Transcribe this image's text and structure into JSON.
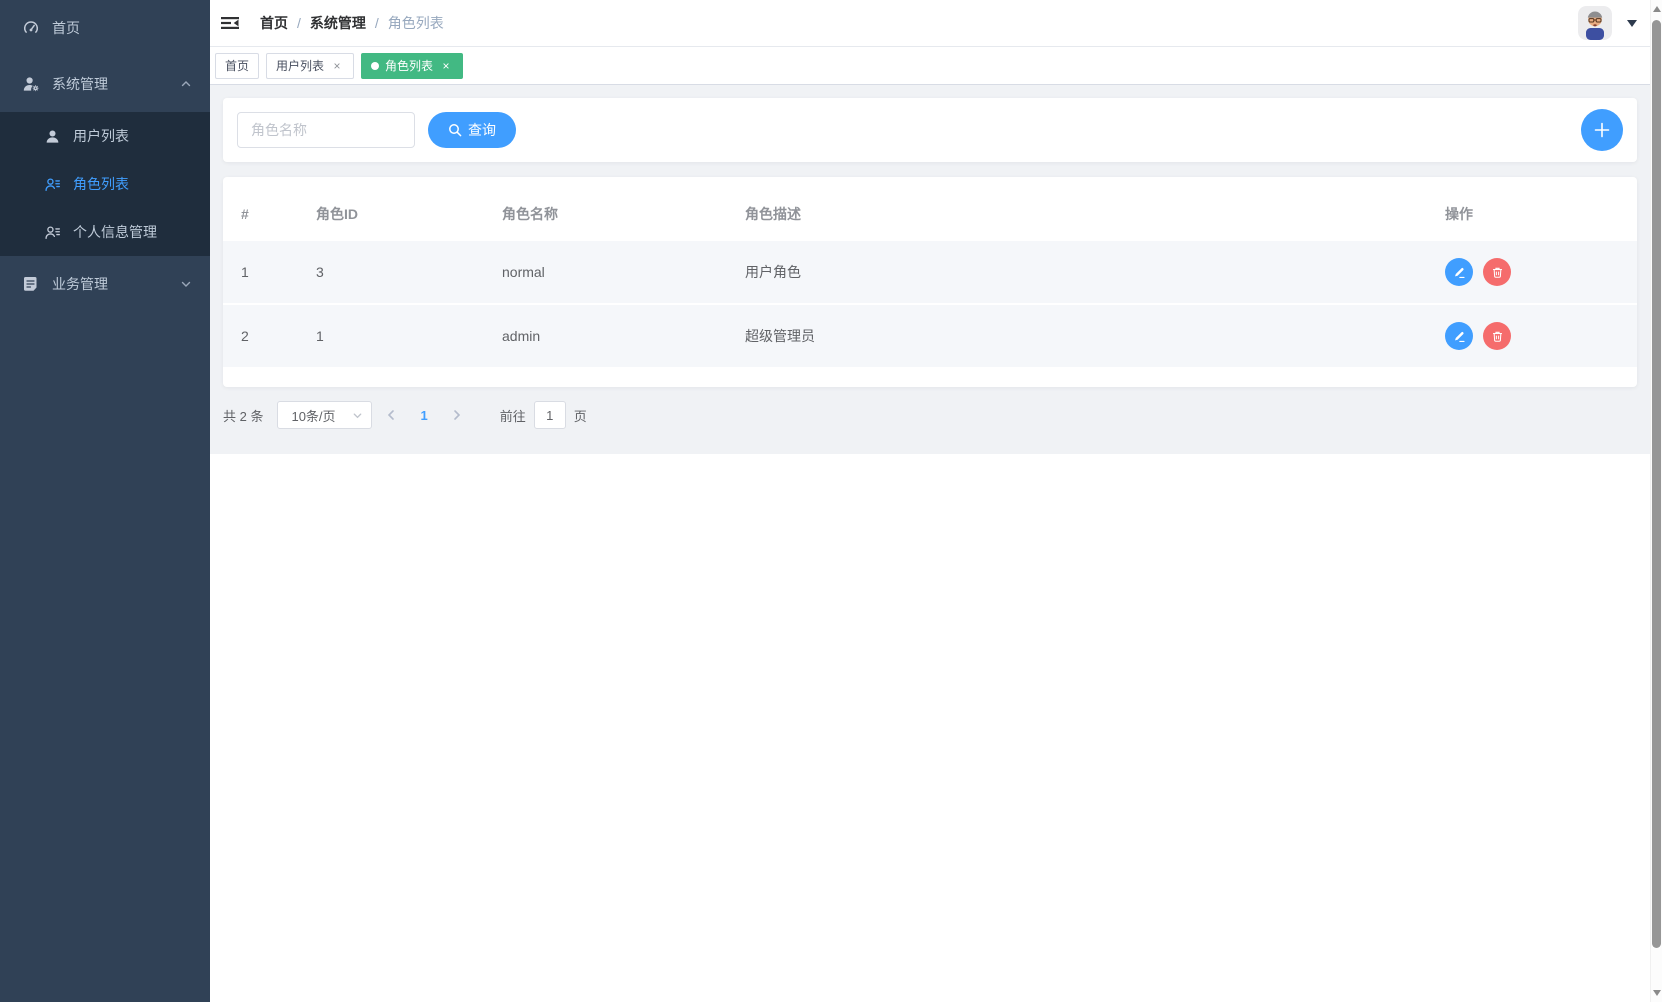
{
  "colors": {
    "primary": "#409eff",
    "active_tab_green": "#42b983",
    "danger": "#f56c6c",
    "sidebar_bg": "#304156",
    "submenu_bg": "#1f2d3d",
    "sidebar_text": "#bfcbd9",
    "content_bg": "#f0f2f5"
  },
  "sidebar": {
    "items": [
      {
        "label": "首页",
        "icon": "dashboard-icon"
      },
      {
        "label": "系统管理",
        "icon": "user-admin-icon",
        "state": "expanded",
        "children": [
          {
            "label": "用户列表",
            "icon": "user-icon"
          },
          {
            "label": "角色列表",
            "icon": "roles-icon",
            "active": true
          },
          {
            "label": "个人信息管理",
            "icon": "profile-icon"
          }
        ]
      },
      {
        "label": "业务管理",
        "icon": "business-icon",
        "state": "collapsed"
      }
    ]
  },
  "navbar": {
    "breadcrumb": [
      "首页",
      "系统管理",
      "角色列表"
    ],
    "separator": "/"
  },
  "tabs": [
    {
      "label": "首页",
      "closable": false,
      "active": false
    },
    {
      "label": "用户列表",
      "closable": true,
      "active": false
    },
    {
      "label": "角色列表",
      "closable": true,
      "active": true
    }
  ],
  "ui": {
    "close_symbol": "×"
  },
  "toolbar": {
    "search_placeholder": "角色名称",
    "search_button": "查询"
  },
  "table": {
    "headers": [
      "#",
      "角色ID",
      "角色名称",
      "角色描述",
      "操作"
    ],
    "rows": [
      {
        "index": "1",
        "role_id": "3",
        "role_name": "normal",
        "role_desc": "用户角色"
      },
      {
        "index": "2",
        "role_id": "1",
        "role_name": "admin",
        "role_desc": "超级管理员"
      }
    ]
  },
  "pagination": {
    "total": "共 2 条",
    "page_size": "10条/页",
    "current_page": "1",
    "goto_label": "前往",
    "goto_value": "1",
    "page_unit": "页"
  }
}
